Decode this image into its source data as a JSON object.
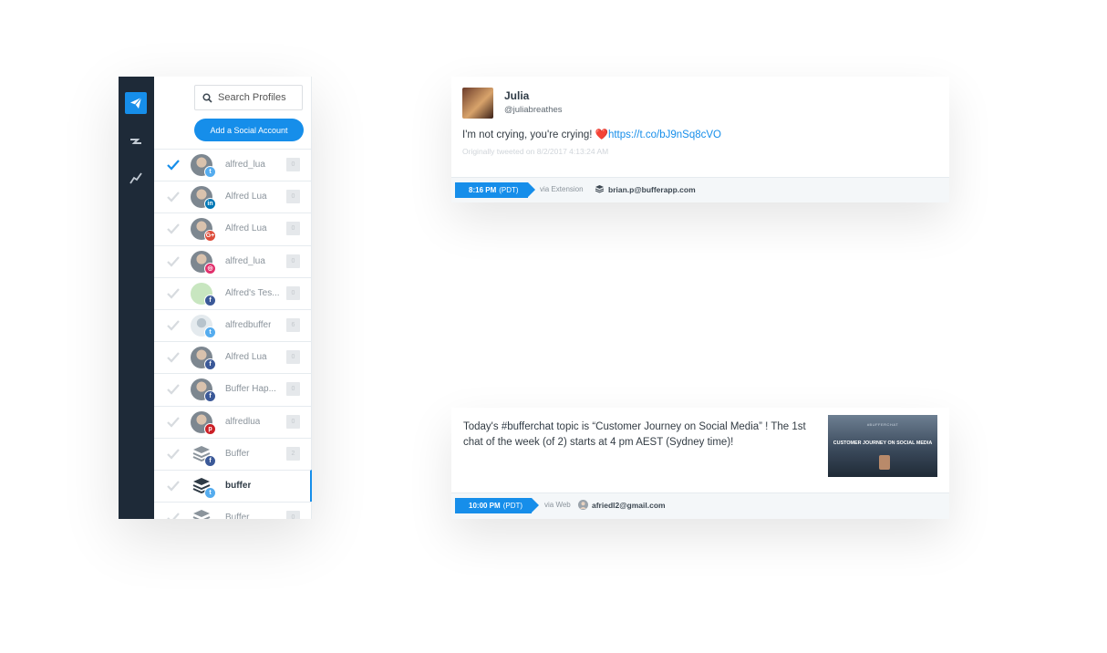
{
  "search": {
    "placeholder": "Search Profiles"
  },
  "add_account_label": "Add a Social Account",
  "profiles": [
    {
      "name": "alfred_lua",
      "network": "twitter",
      "count": "0",
      "checked": true,
      "avatar": "photo"
    },
    {
      "name": "Alfred Lua",
      "network": "linkedin",
      "count": "0",
      "checked": false,
      "avatar": "photo"
    },
    {
      "name": "Alfred Lua",
      "network": "google-plus",
      "count": "0",
      "checked": false,
      "avatar": "photo"
    },
    {
      "name": "alfred_lua",
      "network": "instagram",
      "count": "0",
      "checked": false,
      "avatar": "photo"
    },
    {
      "name": "Alfred's Tes...",
      "network": "facebook",
      "count": "0",
      "checked": false,
      "avatar": "letter"
    },
    {
      "name": "alfredbuffer",
      "network": "twitter",
      "count": "6",
      "checked": false,
      "avatar": "default"
    },
    {
      "name": "Alfred Lua",
      "network": "facebook",
      "count": "0",
      "checked": false,
      "avatar": "photo"
    },
    {
      "name": "Buffer Hap...",
      "network": "facebook",
      "count": "0",
      "checked": false,
      "avatar": "photo"
    },
    {
      "name": "alfredlua",
      "network": "pinterest",
      "count": "0",
      "checked": false,
      "avatar": "photo"
    },
    {
      "name": "Buffer",
      "network": "facebook",
      "count": "2",
      "checked": false,
      "avatar": "buffer"
    },
    {
      "name": "buffer",
      "network": "twitter",
      "count": "",
      "checked": false,
      "avatar": "buffer",
      "selected": true
    },
    {
      "name": "Buffer",
      "network": "twitter",
      "count": "0",
      "checked": false,
      "avatar": "buffer"
    }
  ],
  "network_colors": {
    "twitter": "#55acee",
    "linkedin": "#0077b5",
    "google-plus": "#dd4b39",
    "instagram": "#e1306c",
    "facebook": "#3b5998",
    "pinterest": "#cb2027"
  },
  "network_glyphs": {
    "twitter": "t",
    "linkedin": "in",
    "google-plus": "G+",
    "instagram": "◎",
    "facebook": "f",
    "pinterest": "p"
  },
  "colors": {
    "accent": "#168eea",
    "nav_bg": "#1e2a38"
  },
  "card1": {
    "name": "Julia",
    "handle": "@juliabreathes",
    "text": "I'm not crying, you're crying! ",
    "heart": "❤️",
    "link": "https://t.co/bJ9nSq8cVO",
    "meta": "Originally tweeted on 8/2/2017 4:13:24 AM",
    "time": "8:16 PM",
    "tz": "(PDT)",
    "via": "via Extension",
    "by": "brian.p@bufferapp.com"
  },
  "card2": {
    "text_before": "Today's ",
    "hashtag": "#bufferchat",
    "text_after": " topic is “Customer Journey on Social Media” ! The 1st chat of the week (of 2) starts at 4 pm AEST (Sydney time)!",
    "thumb_top": "#BUFFERCHAT",
    "thumb_title": "CUSTOMER JOURNEY ON SOCIAL MEDIA",
    "time": "10:00 PM",
    "tz": "(PDT)",
    "via": "via Web",
    "by": "afriedl2@gmail.com"
  }
}
